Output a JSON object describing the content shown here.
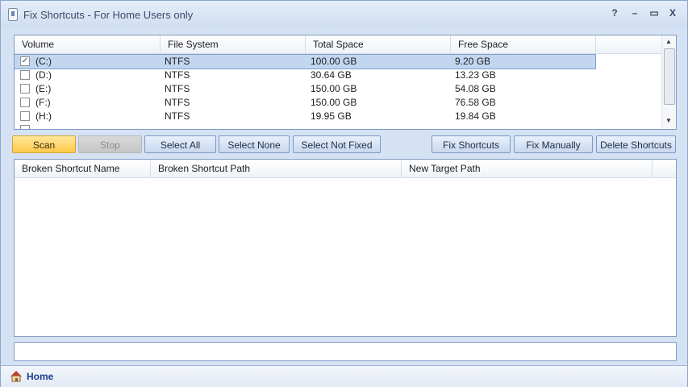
{
  "window": {
    "title": "Fix Shortcuts - For Home Users only"
  },
  "window_controls": {
    "help": "?",
    "minimize": "–",
    "maximize": "▭",
    "close": "X"
  },
  "volumes": {
    "columns": [
      "Volume",
      "File System",
      "Total Space",
      "Free Space"
    ],
    "rows": [
      {
        "checked": true,
        "volume": "(C:)",
        "fs": "NTFS",
        "total": "100.00 GB",
        "free": "9.20 GB"
      },
      {
        "checked": false,
        "volume": "(D:)",
        "fs": "NTFS",
        "total": "30.64 GB",
        "free": "13.23 GB"
      },
      {
        "checked": false,
        "volume": "(E:)",
        "fs": "NTFS",
        "total": "150.00 GB",
        "free": "54.08 GB"
      },
      {
        "checked": false,
        "volume": "(F:)",
        "fs": "NTFS",
        "total": "150.00 GB",
        "free": "76.58 GB"
      },
      {
        "checked": false,
        "volume": "(H:)",
        "fs": "NTFS",
        "total": "19.95 GB",
        "free": "19.84 GB"
      }
    ]
  },
  "toolbar": {
    "scan": "Scan",
    "stop": "Stop",
    "select_all": "Select All",
    "select_none": "Select None",
    "select_not_fixed": "Select Not Fixed",
    "fix_shortcuts": "Fix Shortcuts",
    "fix_manually": "Fix Manually",
    "delete_shortcuts": "Delete Shortcuts"
  },
  "results": {
    "columns": [
      "Broken Shortcut Name",
      "Broken Shortcut Path",
      "New Target Path"
    ]
  },
  "status": {
    "value": ""
  },
  "bottom": {
    "home_label": "Home"
  },
  "icons": {
    "app": "app-icon",
    "home": "home-icon",
    "checkbox": "check-icon"
  },
  "colors": {
    "accent": "#ffc94a",
    "selection": "#c2d6ef",
    "border": "#7f9ac0"
  }
}
